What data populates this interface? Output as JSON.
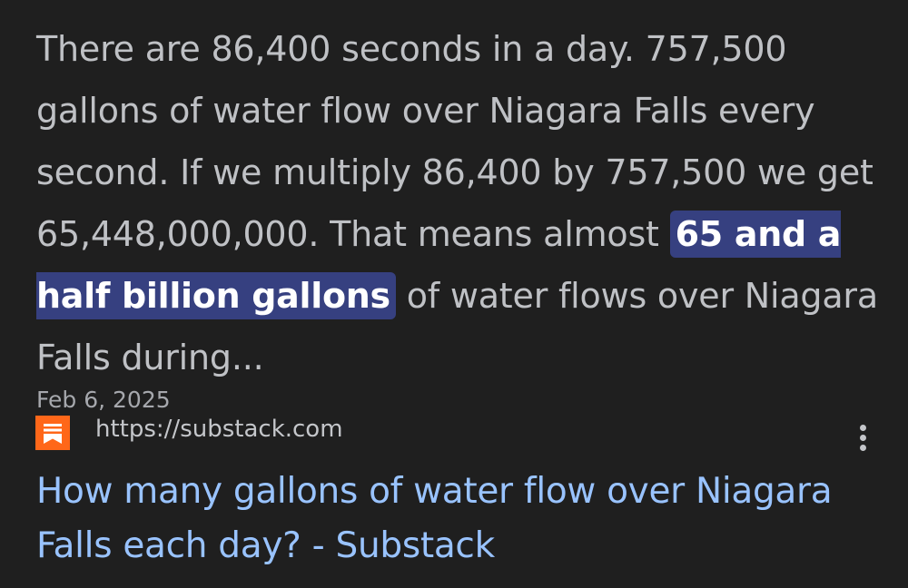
{
  "snippet": {
    "text_before": "There are 86,400 seconds in a day. 757,500 gallons of water flow over Niagara Falls every second. If we multiply 86,400 by 757,500 we get 65,448,000,000. That means almost ",
    "highlight": "65 and a half billion gallons",
    "text_after": " of water flows over Niagara Falls during..."
  },
  "date": "Feb 6, 2025",
  "source": {
    "url": "https://substack.com",
    "favicon_icon": "substack-logo",
    "favicon_color": "#ff6719"
  },
  "result_title": "How many gallons of water flow over Niagara Falls each day? - Substack",
  "menu_icon": "more-vert-icon",
  "colors": {
    "background": "#1f1f1f",
    "snippet_text": "#bfc1c5",
    "highlight_bg": "#364080",
    "link": "#99c3ff"
  }
}
